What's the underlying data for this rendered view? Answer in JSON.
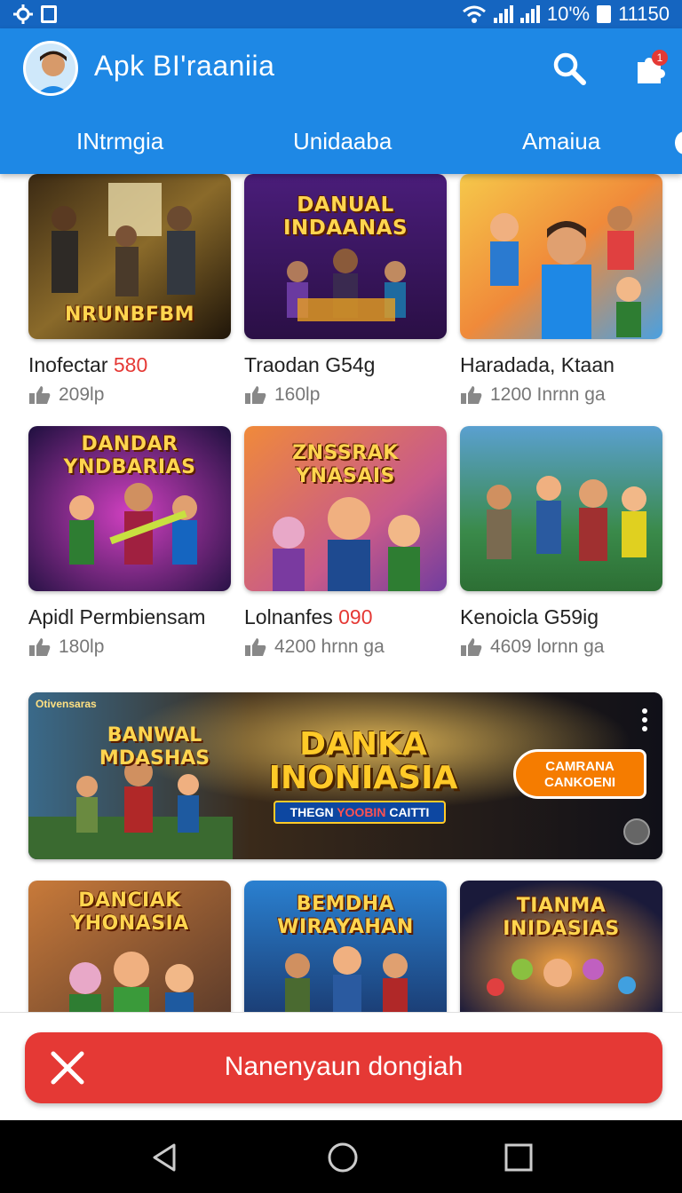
{
  "status_bar": {
    "signal_text": "10'%",
    "time": "11150"
  },
  "app_bar": {
    "title": "Apk BI'raaniia",
    "notification_count": "1",
    "tabs": [
      "INtrmgia",
      "Unidaaba",
      "Amaiua"
    ]
  },
  "grid": [
    {
      "art_title": "NRUNBFBM",
      "name": "Inofectar ",
      "name_highlight": "580",
      "likes": "209lp"
    },
    {
      "art_title": "DANUAL INDAANAS",
      "name": "Traodan G54g",
      "name_highlight": "",
      "likes": "160lp"
    },
    {
      "art_title": "",
      "name": "Haradada, Ktaan",
      "name_highlight": "",
      "likes": "1200 Inrnn ga"
    },
    {
      "art_title": "DANDAR YNDBARIAS",
      "name": "Apidl Permbiensam",
      "name_highlight": "",
      "likes": "180lp"
    },
    {
      "art_title": "ZNSSRAK YNASAIS",
      "name": "Lolnanfes ",
      "name_highlight": "090",
      "likes": "4200  hrnn ga"
    },
    {
      "art_title": "",
      "name": "Kenoicla G59ig",
      "name_highlight": "",
      "likes": "4609 lornn ga"
    },
    {
      "art_title": "DANCIAK YHONASIA",
      "name": "",
      "name_highlight": "",
      "likes": ""
    },
    {
      "art_title": "BEMDHA WIRAYAHAN",
      "name": "",
      "name_highlight": "",
      "likes": ""
    },
    {
      "art_title": "TIANMA INIDASIAS",
      "name": "",
      "name_highlight": "",
      "likes": ""
    }
  ],
  "banner": {
    "corner_label": "Otivensaras",
    "art_title": "BANWAL MDASHAS",
    "main_title": "DANKA INONIASIA",
    "subtitle_left": "THEGN ",
    "subtitle_red": "YOOBIN",
    "subtitle_right": " CAITTI",
    "cta": "CAMRANA CANKOENI"
  },
  "action_button": {
    "label": "Nanenyaun dongiah"
  },
  "colors": {
    "app_bar": "#1e88e5",
    "status_bar": "#1565c0",
    "action": "#e53935",
    "highlight": "#e53935",
    "nav": "#000000"
  }
}
